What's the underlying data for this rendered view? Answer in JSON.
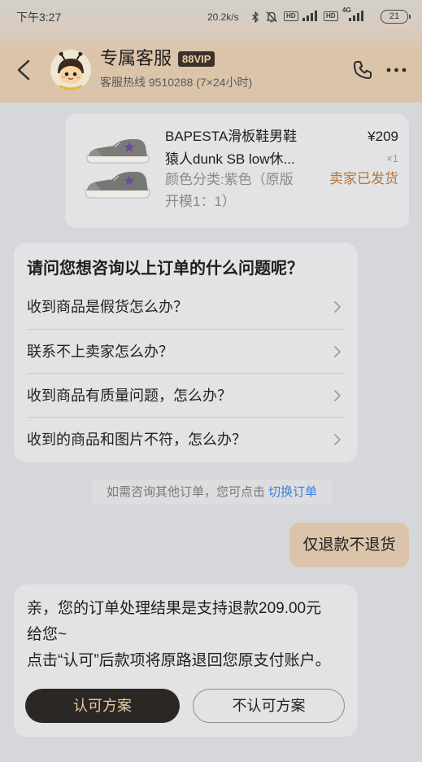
{
  "status_bar": {
    "time": "下午3:27",
    "net_speed": "20.2k/s",
    "hd_label_1": "HD",
    "hd_label_2": "HD",
    "network_type": "4G",
    "battery": "21",
    "icons": [
      "bluetooth-icon",
      "mute-icon",
      "signal-icon",
      "battery-icon"
    ]
  },
  "header": {
    "title": "专属客服",
    "badge": "88VIP",
    "subtitle": "客服热线 9510288 (7×24小时)",
    "icons": {
      "back": "back-arrow-icon",
      "avatar": "avatar-icon",
      "call": "phone-icon",
      "more": "more-icon"
    }
  },
  "order_card": {
    "title_lines": [
      "BAPESTA滑板鞋男鞋",
      "猿人dunk SB low休..."
    ],
    "spec_lines": [
      "颜色分类:紫色（原版",
      "开模1：1）"
    ],
    "price": "¥209",
    "quantity": "×1",
    "status": "卖家已发货",
    "image_icon": "sneaker-icon"
  },
  "faq_card": {
    "title": "请问您想咨询以上订单的什么问题呢？",
    "items": [
      {
        "text": "收到商品是假货怎么办？"
      },
      {
        "text": "联系不上卖家怎么办？"
      },
      {
        "text": "收到商品有质量问题，怎么办？"
      },
      {
        "text": "收到的商品和图片不符，怎么办？"
      }
    ],
    "item_icon": "chevron-right-icon"
  },
  "system_tip": {
    "text": "如需咨询其他订单，您可点击",
    "link": "切换订单"
  },
  "user_message": {
    "text": "仅退款不退货"
  },
  "bot_message": {
    "lines": [
      "亲，您的订单处理结果是支持退款209.00元",
      "给您~",
      "点击“认可”后款项将原路退回您原支付账户。"
    ],
    "accept_label": "认可方案",
    "reject_label": "不认可方案"
  },
  "colors": {
    "page_bg": "#d6d7db",
    "header_bg": "#dcc4aa",
    "card_bg": "#e3e3e5",
    "tip_bg": "#dddde0",
    "accent_text": "#b4753a",
    "link": "#3c7dd8",
    "badge_bg": "#3a322c",
    "badge_text": "#f0cfa3",
    "primary_button_bg": "#2a2725",
    "primary_button_text": "#ecc79c",
    "user_bubble_bg": "#dcc4aa"
  }
}
